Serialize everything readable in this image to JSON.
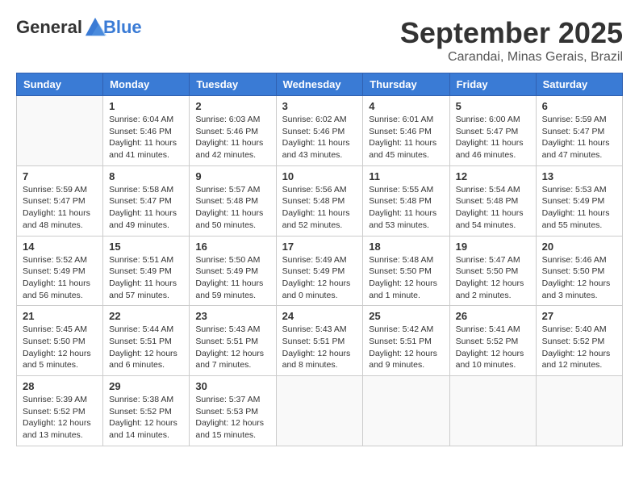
{
  "header": {
    "logo_general": "General",
    "logo_blue": "Blue",
    "month_title": "September 2025",
    "subtitle": "Carandai, Minas Gerais, Brazil"
  },
  "days_of_week": [
    "Sunday",
    "Monday",
    "Tuesday",
    "Wednesday",
    "Thursday",
    "Friday",
    "Saturday"
  ],
  "weeks": [
    [
      {
        "day": "",
        "info": ""
      },
      {
        "day": "1",
        "info": "Sunrise: 6:04 AM\nSunset: 5:46 PM\nDaylight: 11 hours\nand 41 minutes."
      },
      {
        "day": "2",
        "info": "Sunrise: 6:03 AM\nSunset: 5:46 PM\nDaylight: 11 hours\nand 42 minutes."
      },
      {
        "day": "3",
        "info": "Sunrise: 6:02 AM\nSunset: 5:46 PM\nDaylight: 11 hours\nand 43 minutes."
      },
      {
        "day": "4",
        "info": "Sunrise: 6:01 AM\nSunset: 5:46 PM\nDaylight: 11 hours\nand 45 minutes."
      },
      {
        "day": "5",
        "info": "Sunrise: 6:00 AM\nSunset: 5:47 PM\nDaylight: 11 hours\nand 46 minutes."
      },
      {
        "day": "6",
        "info": "Sunrise: 5:59 AM\nSunset: 5:47 PM\nDaylight: 11 hours\nand 47 minutes."
      }
    ],
    [
      {
        "day": "7",
        "info": "Sunrise: 5:59 AM\nSunset: 5:47 PM\nDaylight: 11 hours\nand 48 minutes."
      },
      {
        "day": "8",
        "info": "Sunrise: 5:58 AM\nSunset: 5:47 PM\nDaylight: 11 hours\nand 49 minutes."
      },
      {
        "day": "9",
        "info": "Sunrise: 5:57 AM\nSunset: 5:48 PM\nDaylight: 11 hours\nand 50 minutes."
      },
      {
        "day": "10",
        "info": "Sunrise: 5:56 AM\nSunset: 5:48 PM\nDaylight: 11 hours\nand 52 minutes."
      },
      {
        "day": "11",
        "info": "Sunrise: 5:55 AM\nSunset: 5:48 PM\nDaylight: 11 hours\nand 53 minutes."
      },
      {
        "day": "12",
        "info": "Sunrise: 5:54 AM\nSunset: 5:48 PM\nDaylight: 11 hours\nand 54 minutes."
      },
      {
        "day": "13",
        "info": "Sunrise: 5:53 AM\nSunset: 5:49 PM\nDaylight: 11 hours\nand 55 minutes."
      }
    ],
    [
      {
        "day": "14",
        "info": "Sunrise: 5:52 AM\nSunset: 5:49 PM\nDaylight: 11 hours\nand 56 minutes."
      },
      {
        "day": "15",
        "info": "Sunrise: 5:51 AM\nSunset: 5:49 PM\nDaylight: 11 hours\nand 57 minutes."
      },
      {
        "day": "16",
        "info": "Sunrise: 5:50 AM\nSunset: 5:49 PM\nDaylight: 11 hours\nand 59 minutes."
      },
      {
        "day": "17",
        "info": "Sunrise: 5:49 AM\nSunset: 5:49 PM\nDaylight: 12 hours\nand 0 minutes."
      },
      {
        "day": "18",
        "info": "Sunrise: 5:48 AM\nSunset: 5:50 PM\nDaylight: 12 hours\nand 1 minute."
      },
      {
        "day": "19",
        "info": "Sunrise: 5:47 AM\nSunset: 5:50 PM\nDaylight: 12 hours\nand 2 minutes."
      },
      {
        "day": "20",
        "info": "Sunrise: 5:46 AM\nSunset: 5:50 PM\nDaylight: 12 hours\nand 3 minutes."
      }
    ],
    [
      {
        "day": "21",
        "info": "Sunrise: 5:45 AM\nSunset: 5:50 PM\nDaylight: 12 hours\nand 5 minutes."
      },
      {
        "day": "22",
        "info": "Sunrise: 5:44 AM\nSunset: 5:51 PM\nDaylight: 12 hours\nand 6 minutes."
      },
      {
        "day": "23",
        "info": "Sunrise: 5:43 AM\nSunset: 5:51 PM\nDaylight: 12 hours\nand 7 minutes."
      },
      {
        "day": "24",
        "info": "Sunrise: 5:43 AM\nSunset: 5:51 PM\nDaylight: 12 hours\nand 8 minutes."
      },
      {
        "day": "25",
        "info": "Sunrise: 5:42 AM\nSunset: 5:51 PM\nDaylight: 12 hours\nand 9 minutes."
      },
      {
        "day": "26",
        "info": "Sunrise: 5:41 AM\nSunset: 5:52 PM\nDaylight: 12 hours\nand 10 minutes."
      },
      {
        "day": "27",
        "info": "Sunrise: 5:40 AM\nSunset: 5:52 PM\nDaylight: 12 hours\nand 12 minutes."
      }
    ],
    [
      {
        "day": "28",
        "info": "Sunrise: 5:39 AM\nSunset: 5:52 PM\nDaylight: 12 hours\nand 13 minutes."
      },
      {
        "day": "29",
        "info": "Sunrise: 5:38 AM\nSunset: 5:52 PM\nDaylight: 12 hours\nand 14 minutes."
      },
      {
        "day": "30",
        "info": "Sunrise: 5:37 AM\nSunset: 5:53 PM\nDaylight: 12 hours\nand 15 minutes."
      },
      {
        "day": "",
        "info": ""
      },
      {
        "day": "",
        "info": ""
      },
      {
        "day": "",
        "info": ""
      },
      {
        "day": "",
        "info": ""
      }
    ]
  ]
}
